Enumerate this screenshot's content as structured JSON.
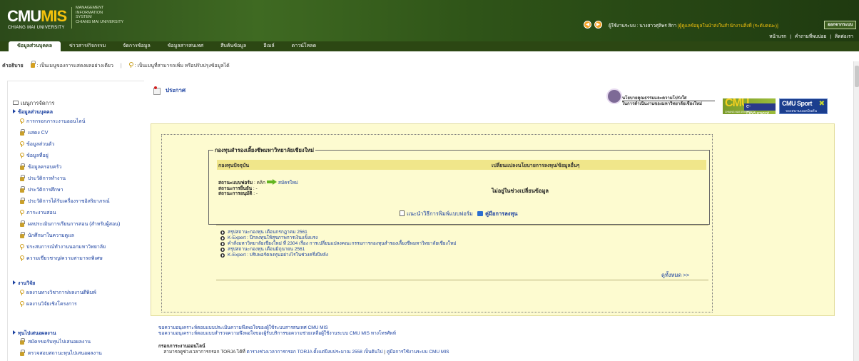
{
  "header": {
    "logo_cmu": "CMU",
    "logo_mis": "MIS",
    "logo_sub": "CHIANG MAI UNIVERSITY",
    "logo_desc": [
      "MANAGEMENT",
      "INFORMATION",
      "SYSTEM",
      "CHIANG MAI UNIVERSITY"
    ],
    "user_prefix": "ผู้ใช้งานระบบ : นางสาวศุลิพร สิกา",
    "user_role": "[ผู้ดูแลข้อมูลในนำส่งในสำนักงานสิ่งที่ (ระดับคณะ)]",
    "logout_label": "ออกจากระบบ",
    "top_links": [
      "หน้าแรก",
      "คำถามที่พบบ่อย",
      "ติดต่อเรา"
    ],
    "colors": {
      "header_bg": "#2c4a1a",
      "accent": "#f4c20d",
      "link": "#1a40a0",
      "panel_bg": "#fdfbd0"
    }
  },
  "tabs": [
    {
      "label": "ข้อมูลส่วนบุคคล",
      "active": true
    },
    {
      "label": "ข่าวสาร/กิจกรรม",
      "active": false
    },
    {
      "label": "จัดการข้อมูล",
      "active": false
    },
    {
      "label": "ข้อมูลสารสนเทศ",
      "active": false
    },
    {
      "label": "สืบค้นข้อมูล",
      "active": false
    },
    {
      "label": "อีเมล์",
      "active": false
    },
    {
      "label": "ดาวน์โหลด",
      "active": false
    }
  ],
  "legend": {
    "label": "คำอธิบาย",
    "lock_text": ": เป็นเมนูของการแสดงผลอย่างเดียว",
    "key_text": ": เป็นเมนูที่สามารถเพิ่ม หรือปรับปรุงข้อมูลได้",
    "sep": "|"
  },
  "sidebar": {
    "title": "เมนูการจัดการ",
    "sections": [
      {
        "label": "ข้อมูลส่วนบุคคล",
        "items": [
          {
            "label": "การกรอกภาระงานออนไลน์",
            "icon": "key-icon"
          },
          {
            "label": "แสดง CV",
            "icon": "lock-icon"
          },
          {
            "label": "ข้อมูลส่วนตัว",
            "icon": "key-icon"
          },
          {
            "label": "ข้อมูลที่อยู่",
            "icon": "key-icon"
          },
          {
            "label": "ข้อมูลครอบครัว",
            "icon": "lock-icon"
          },
          {
            "label": "ประวัติการทำงาน",
            "icon": "lock-icon"
          },
          {
            "label": "ประวัติการศึกษา",
            "icon": "lock-icon"
          },
          {
            "label": "ประวัติการได้รับเครื่องราชอิสริยาภรณ์",
            "icon": "lock-icon"
          },
          {
            "label": "ภาระงานสอน",
            "icon": "key-icon"
          },
          {
            "label": "ผลประเมินการเรียนการสอน (สำหรับผู้สอน)",
            "icon": "lock-icon"
          },
          {
            "label": "นักศึกษาในความดูแล",
            "icon": "lock-icon"
          },
          {
            "label": "ประสบการณ์ทำงานนอกมหาวิทยาลัย",
            "icon": "key-icon"
          },
          {
            "label": "ความเชี่ยวชาญ/ความสามารถพิเศษ",
            "icon": "key-icon"
          }
        ]
      },
      {
        "label": "งานวิจัย",
        "items": [
          {
            "label": "ผลงานทางวิชาการ/ผลงานตีพิมพ์",
            "icon": "key-icon"
          },
          {
            "label": "ผลงานวิจัยเชิงโครงการ",
            "icon": "key-icon"
          }
        ]
      },
      {
        "label": "ทุนไปเสนอผลงาน",
        "items": [
          {
            "label": "สมัครขอรับทุนไปเสนอผลงาน",
            "icon": "lock-icon"
          },
          {
            "label": "ตรวจสอบสถานะทุนไปเสนอผลงาน",
            "icon": "lock-icon"
          }
        ]
      }
    ]
  },
  "announcement": {
    "title": "ประกาศ"
  },
  "banners": {
    "gov_line1": "นโยบายคุณธรรมและความโปร่งใส",
    "gov_line2": "ในการดำเนินงานของมหาวิทยาลัยเชียงใหม่",
    "edoc_cmu": "CMU",
    "edoc_label": "e-Document",
    "edoc_sub": "CHIANG MAI UNIVERSITY",
    "sport_title": "CMU Sport",
    "sport_sub": "จองสนามแบดมินตัน"
  },
  "fund": {
    "legend": "กองทุนสำรองเลี้ยงชีพมหาวิทยาลัยเชียงใหม่",
    "col_current": "กองทุนปัจจุบัน",
    "col_change": "เปลี่ยนแปลงนโยบายการลงทุน/ข้อมูลอื่นๆ",
    "status_form_label": "สถานะแบบฟอร์ม",
    "status_form_value": ": คลิก",
    "apply_link": "สมัครใหม่",
    "status_submit_label": "สถานะการยื่นยัน",
    "status_submit_value": ": -",
    "status_approve_label": "สถานะการอนุมัติ",
    "status_approve_value": ": -",
    "no_change": "ไม่อยู่ในช่วงเปลี่ยนข้อมูล",
    "howto_text": "แนะนำวิธีการพิมพ์แบบฟอร์ม",
    "manual_text": "คู่มือการลงทุน"
  },
  "news": {
    "items": [
      "สรุปสถานะกองทุน เดือนกรกฎาคม 2561",
      "K-Expert : ปีกลงทุนให้สุขภาพการเงินแข็งแรง",
      "คำสั่งมหาวิทยาลัยเชียงใหม่ ที่ 2304 เรื่อง การเปลี่ยนแปลงคณะกรรมการกองทุนสำรองเลี้ยงชีพมหาวิทยาลัยเชียงใหม่",
      "สรุปสถานะกองทุน เดือนมิถุนายน 2561",
      "K-Expert : ปรับพอร์ตลงทุนอย่างไรในช่วงครึ่งปีหลัง"
    ],
    "view_all": "ดูทั้งหมด >>"
  },
  "bottom": {
    "link1": "ขอความอนุเคราะห์ตอบแบบประเมินความพึงพอใจของผู้ใช้ระบบสารสนเทศ CMU MIS",
    "link2": "ขอความอนุเคราะห์ตอบแบบสำรวจความพึงพอใจของผู้รับบริการขอความช่วยเหลือผู้ใช้งานระบบ CMU MIS ทางโทรศัพท์",
    "fill_title": "กรอกภาระงานออนไลน์",
    "fill_text": "สามารถดูช่วงเวลาการกรอก TORJA ได้ที่",
    "fill_link1": "ตารางช่วงเวลาการกรอก TORJA ตั้งแต่ปีงบประมาณ 2558 เป็นต้นไป",
    "fill_sep": "|",
    "fill_link2": "คู่มือการใช้งานระบบ CMU MIS"
  }
}
